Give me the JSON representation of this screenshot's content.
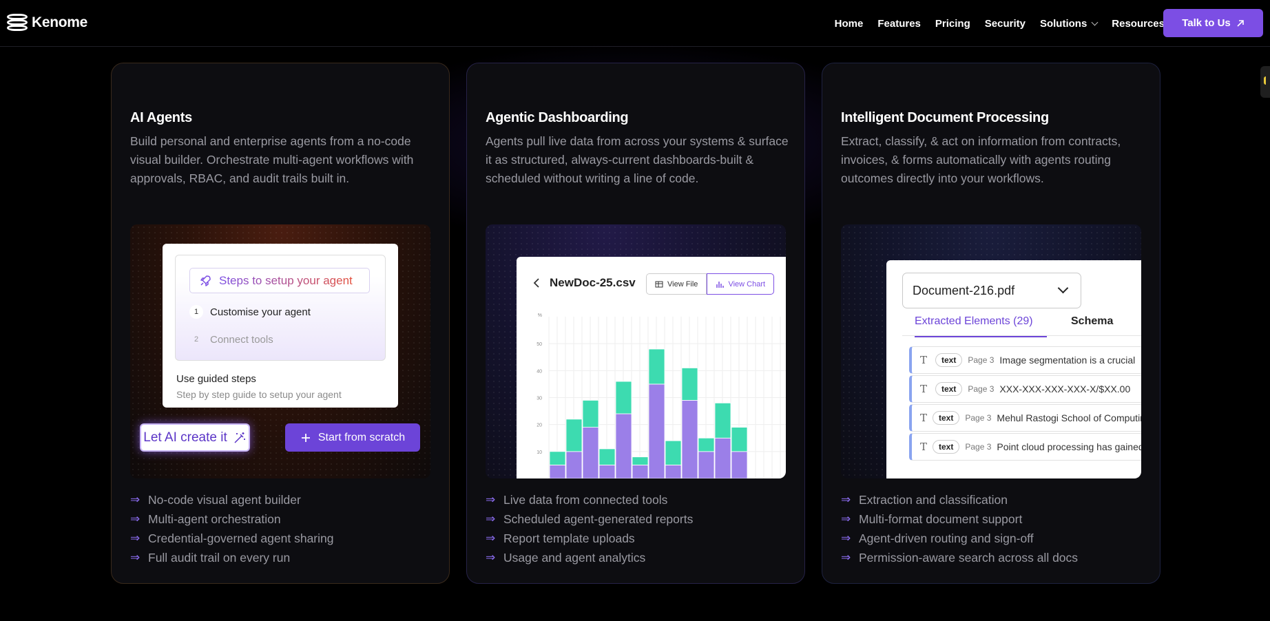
{
  "nav": {
    "logo_text": "Kenome",
    "links": [
      {
        "label": "Home"
      },
      {
        "label": "Features"
      },
      {
        "label": "Pricing"
      },
      {
        "label": "Security"
      },
      {
        "label": "Solutions",
        "dropdown": true
      },
      {
        "label": "Resources",
        "dropdown": true
      }
    ],
    "cta_label": "Talk to Us",
    "cta_icon": "arrow-up-right-icon",
    "accent_color": "#7c4ee4"
  },
  "cards": [
    {
      "title": "AI Agents",
      "description": "Build personal and enterprise agents from a no-code visual builder. Orchestrate multi-agent workflows with approvals, RBAC, and audit trails built in.",
      "mock": {
        "pill_label": "Steps to setup your agent",
        "pill_icon": "rocket-icon",
        "steps": [
          {
            "num": "1",
            "label": "Customise your agent"
          },
          {
            "num": "2",
            "label": "Connect tools"
          }
        ],
        "guided_title": "Use guided steps",
        "guided_subtitle": "Step by step guide to setup your agent",
        "ai_button": "Let AI create it",
        "ai_button_icon": "magic-wand-icon",
        "scratch_button": "Start from scratch",
        "scratch_button_icon": "plus-icon"
      },
      "bullets": [
        "No-code visual agent builder",
        "Multi-agent orchestration",
        "Credential-governed agent sharing",
        "Full audit trail on every run"
      ]
    },
    {
      "title": "Agentic Dashboarding",
      "description": "Agents pull live data from across your systems & surface it as structured, always-current dashboards-built & scheduled without writing a line of code.",
      "mock": {
        "file_name": "NewDoc-25.csv",
        "back_icon": "chevron-left-icon",
        "view_file": "View File",
        "view_file_icon": "table-icon",
        "view_chart": "View Chart",
        "view_chart_icon": "bar-chart-icon"
      },
      "bullets": [
        "Live data from connected tools",
        "Scheduled agent-generated reports",
        "Report template uploads",
        "Usage and agent analytics"
      ]
    },
    {
      "title": "Intelligent Document Processing",
      "description": "Extract, classify, & act on information from contracts, invoices, & forms automatically with agents routing outcomes directly into your workflows.",
      "mock": {
        "document": "Document-216.pdf",
        "tab_active": "Extracted Elements (29)",
        "tab_inactive": "Schema",
        "rows": [
          {
            "type": "text",
            "page": "Page 3",
            "content": "Image segmentation is a crucial"
          },
          {
            "type": "text",
            "page": "Page 3",
            "content": "XXX-XXX-XXX-XXX-X/$XX.00"
          },
          {
            "type": "text",
            "page": "Page 3",
            "content": "Mehul Rastogi School of Computing"
          },
          {
            "type": "text",
            "page": "Page 3",
            "content": "Point cloud processing has gained"
          }
        ]
      },
      "bullets": [
        "Extraction and classification",
        "Multi-format document support",
        "Agent-driven routing and sign-off",
        "Permission-aware search across all docs"
      ]
    }
  ],
  "chart_data": {
    "type": "bar",
    "stacked": true,
    "yunit": "%",
    "ylim": [
      0,
      60
    ],
    "yticks": [
      10,
      20,
      30,
      40,
      50
    ],
    "series": [
      {
        "color": "#9b7fe8",
        "values": [
          5,
          10,
          19,
          5,
          24,
          5,
          35,
          5,
          29,
          10,
          15,
          10
        ]
      },
      {
        "color": "#3ddbb0",
        "values": [
          5,
          12,
          10,
          6,
          12,
          3,
          13,
          9,
          12,
          5,
          13,
          9
        ]
      }
    ]
  }
}
